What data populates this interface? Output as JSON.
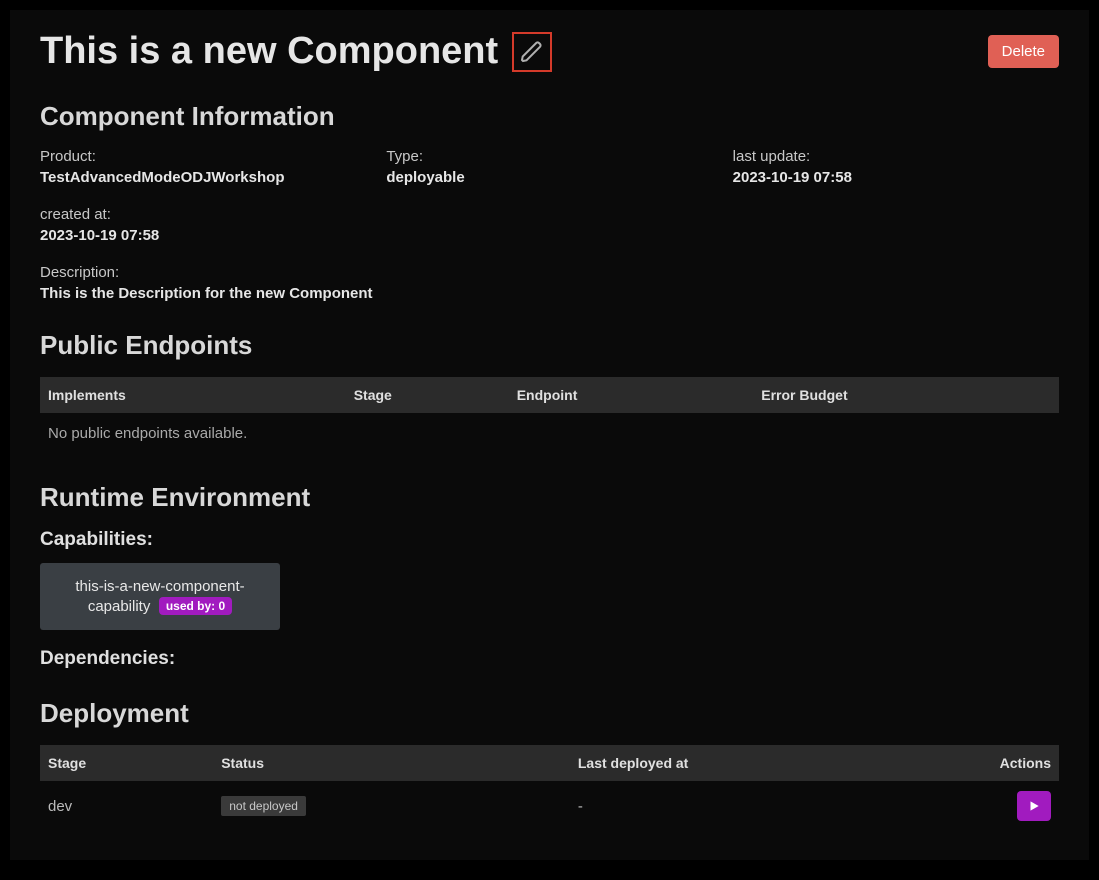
{
  "header": {
    "title": "This is a new Component",
    "delete_label": "Delete"
  },
  "info": {
    "section_title": "Component Information",
    "product_label": "Product:",
    "product_value": "TestAdvancedModeODJWorkshop",
    "type_label": "Type:",
    "type_value": "deployable",
    "last_update_label": "last update:",
    "last_update_value": "2023-10-19 07:58",
    "created_label": "created at:",
    "created_value": "2023-10-19 07:58",
    "description_label": "Description:",
    "description_value": "This is the Description for the new Component"
  },
  "endpoints": {
    "section_title": "Public Endpoints",
    "headers": {
      "implements": "Implements",
      "stage": "Stage",
      "endpoint": "Endpoint",
      "error_budget": "Error Budget"
    },
    "empty_message": "No public endpoints available."
  },
  "runtime": {
    "section_title": "Runtime Environment",
    "capabilities_title": "Capabilities:",
    "dependencies_title": "Dependencies:",
    "capability": {
      "name": "this-is-a-new-component-capability",
      "badge": "used by: 0"
    }
  },
  "deployment": {
    "section_title": "Deployment",
    "headers": {
      "stage": "Stage",
      "status": "Status",
      "last_deployed": "Last deployed at",
      "actions": "Actions"
    },
    "row": {
      "stage": "dev",
      "status": "not deployed",
      "last_deployed": "-"
    }
  }
}
